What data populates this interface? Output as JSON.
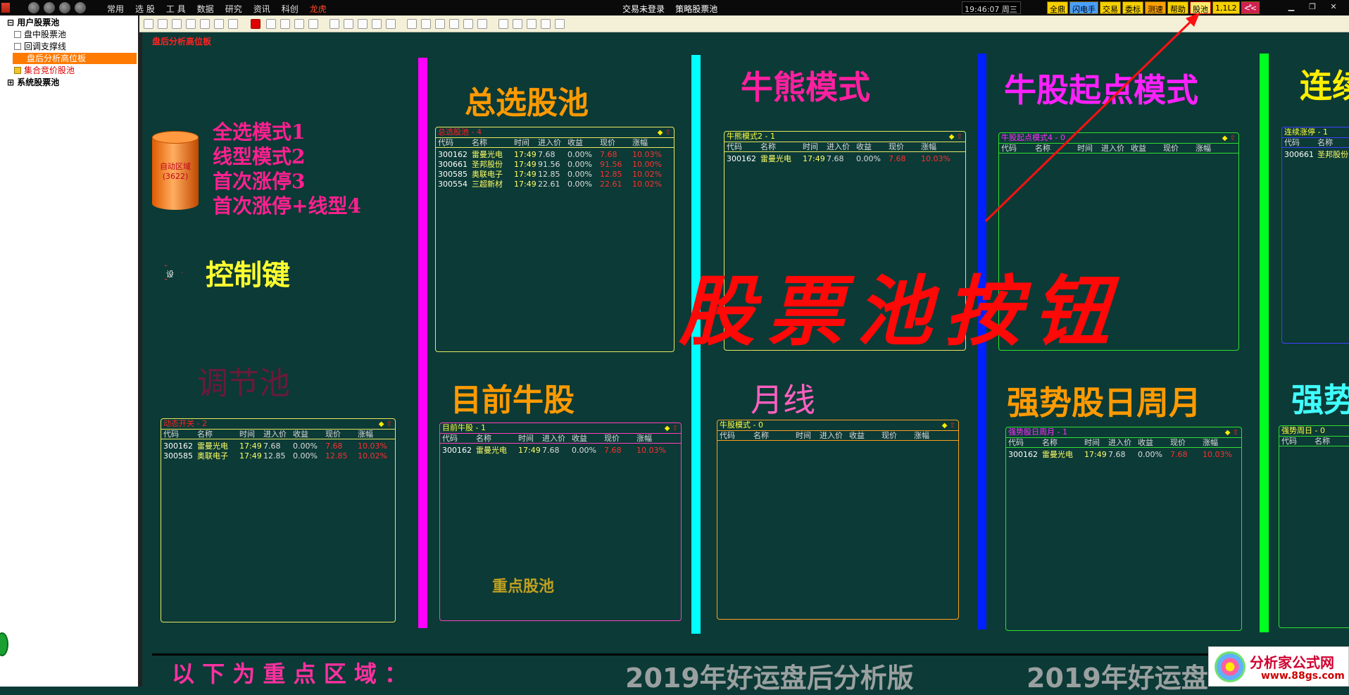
{
  "topbar": {
    "menu": [
      "常用",
      "选 股",
      "工 具",
      "数据",
      "研究",
      "资讯",
      "科创",
      "龙虎"
    ],
    "center_left": "交易未登录",
    "center_right": "策略股票池",
    "clock": "19:46:07 周三",
    "buttons": [
      "全鼎",
      "闪电手",
      "交易",
      "委标",
      "测速",
      "帮助",
      "股池",
      "1,1L2",
      "<<"
    ]
  },
  "sidebar": {
    "items": [
      {
        "label": "用户股票池"
      },
      {
        "label": "盘中股票池"
      },
      {
        "label": "回调支撑线"
      },
      {
        "label": "盘后分析高位板"
      },
      {
        "label": "集合竞价股池"
      },
      {
        "label": "系统股票池"
      }
    ]
  },
  "breadcrumb": "盘后分析高位板",
  "cylinder": {
    "label": "自动区域",
    "count": "(3622)"
  },
  "modes": [
    "全选模式1",
    "线型模式2",
    "首次涨停3",
    "首次涨停+线型4"
  ],
  "set_button": "设",
  "headings": {
    "control": "控制键",
    "adjust": "调节池",
    "total": "总选股池",
    "bull_now": "目前牛股",
    "bull_bear": "牛熊模式",
    "monthly": "月线",
    "bull_start": "牛股起点模式",
    "strong": "强势股日周月",
    "consecutive": "连续",
    "strong2": "强势",
    "key_pool": "重点股池",
    "overlay": "股票池按钮",
    "bottom": "以 下 为 重 点 区 域 ：",
    "edition1": "2019年好运盘后分析版",
    "edition2": "2019年好运盘"
  },
  "table_header": [
    "代码",
    "名称",
    "时间",
    "进入价",
    "收益",
    "现价",
    "涨幅"
  ],
  "panels": {
    "dynamic": {
      "title": "动态开关 - 2",
      "rows": [
        [
          "300162",
          "雷曼光电",
          "17:49",
          "7.68",
          "0.00%",
          "7.68",
          "10.03%"
        ],
        [
          "300585",
          "奥联电子",
          "17:49",
          "12.85",
          "0.00%",
          "12.85",
          "10.02%"
        ]
      ]
    },
    "total": {
      "title": "总选股池 - 4",
      "rows": [
        [
          "300162",
          "雷曼光电",
          "17:49",
          "7.68",
          "0.00%",
          "7.68",
          "10.03%"
        ],
        [
          "300661",
          "圣邦股份",
          "17:49",
          "91.56",
          "0.00%",
          "91.56",
          "10.00%"
        ],
        [
          "300585",
          "奥联电子",
          "17:49",
          "12.85",
          "0.00%",
          "12.85",
          "10.02%"
        ],
        [
          "300554",
          "三超新材",
          "17:49",
          "22.61",
          "0.00%",
          "22.61",
          "10.02%"
        ]
      ]
    },
    "bullnow": {
      "title": "目前牛股 - 1",
      "rows": [
        [
          "300162",
          "雷曼光电",
          "17:49",
          "7.68",
          "0.00%",
          "7.68",
          "10.03%"
        ]
      ]
    },
    "bullbear": {
      "title": "牛熊模式2 - 1",
      "rows": [
        [
          "300162",
          "雷曼光电",
          "17:49",
          "7.68",
          "0.00%",
          "7.68",
          "10.03%"
        ]
      ]
    },
    "monthly": {
      "title": "牛股模式 - 0",
      "rows": []
    },
    "bullstart": {
      "title": "牛股起点模式4 - 0",
      "rows": []
    },
    "strong": {
      "title": "强势股日周月 - 1",
      "rows": [
        [
          "300162",
          "雷曼光电",
          "17:49",
          "7.68",
          "0.00%",
          "7.68",
          "10.03%"
        ]
      ]
    },
    "consecutive": {
      "title": "连续涨停 - 1",
      "rows": [
        [
          "300661",
          "圣邦股份"
        ]
      ]
    },
    "strong2": {
      "title": "强势周日 - 0",
      "rows": []
    }
  },
  "logo": {
    "title": "分析家公式网",
    "url": "www.88gs.com"
  }
}
